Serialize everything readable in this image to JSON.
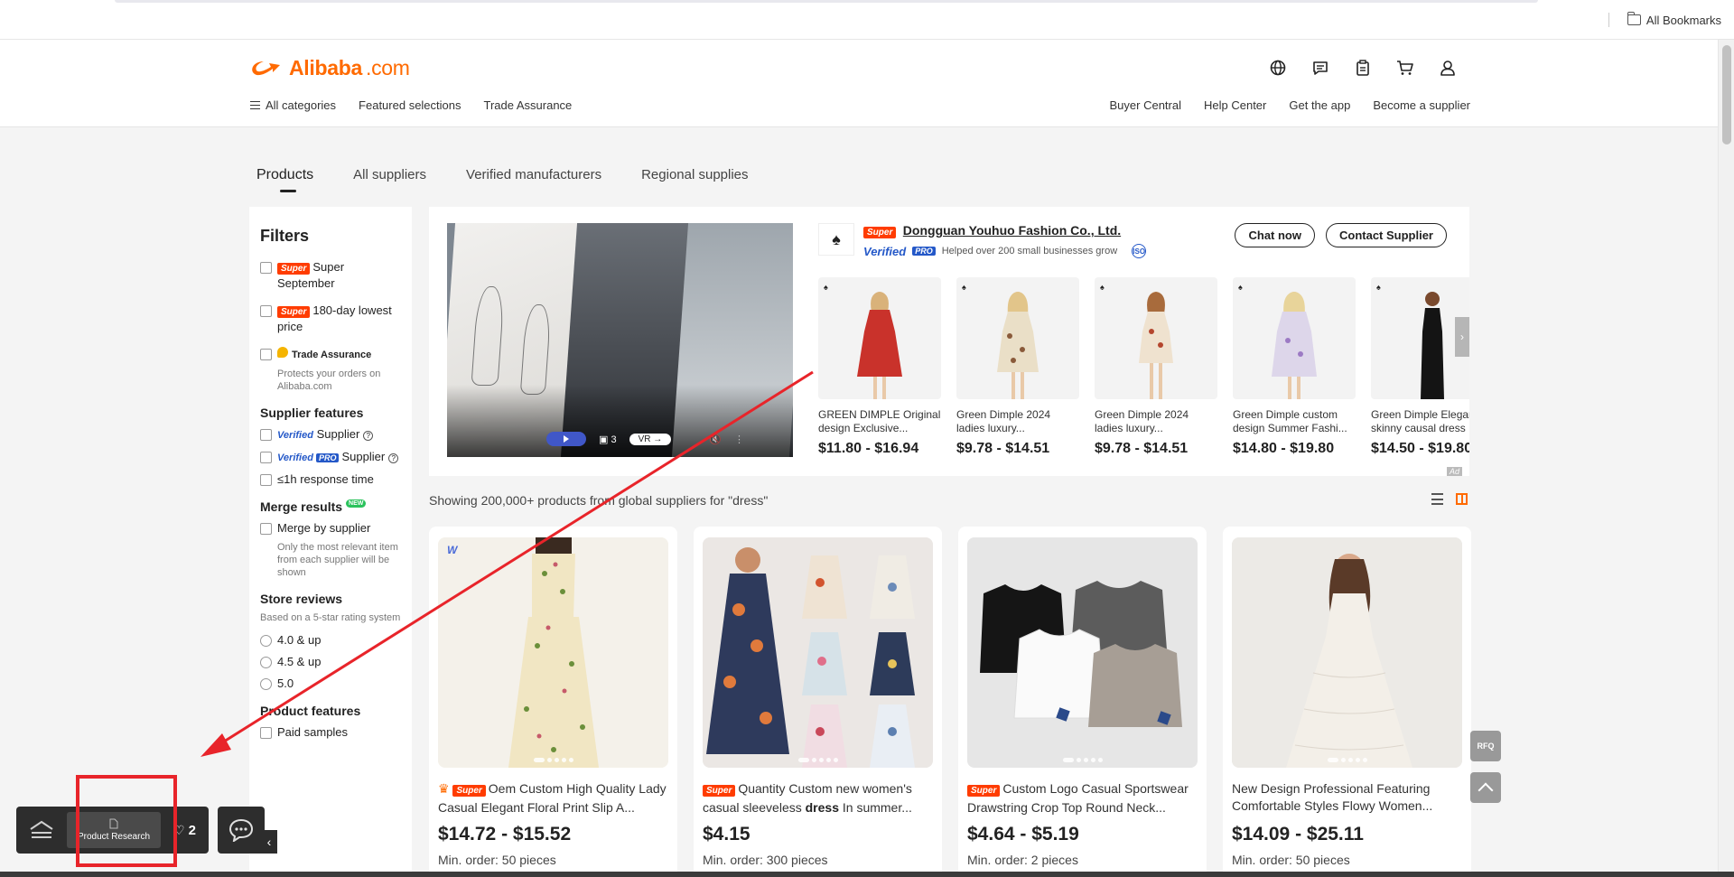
{
  "browser": {
    "bookmarks_label": "All Bookmarks"
  },
  "header": {
    "logo_text": "Alibaba",
    "logo_suffix": ".com",
    "icons": [
      "globe-icon",
      "message-icon",
      "orders-icon",
      "cart-icon",
      "user-icon"
    ],
    "nav_left": [
      "All categories",
      "Featured selections",
      "Trade Assurance"
    ],
    "nav_right": [
      "Buyer Central",
      "Help Center",
      "Get the app",
      "Become a supplier"
    ]
  },
  "tabs": [
    "Products",
    "All suppliers",
    "Verified manufacturers",
    "Regional supplies"
  ],
  "filters": {
    "title": "Filters",
    "super_tag": "Super",
    "super_september": "Super September",
    "lowest_price": "180-day lowest price",
    "trade_assurance": "Trade Assurance",
    "trade_assurance_note": "Protects your orders on Alibaba.com",
    "supplier_features_title": "Supplier features",
    "verified_word": "Verified",
    "pro_word": "PRO",
    "supplier_word": "Supplier",
    "response_time": "≤1h response time",
    "merge_title": "Merge results",
    "new_badge": "NEW",
    "merge_by_supplier": "Merge by supplier",
    "merge_note": "Only the most relevant item from each supplier will be shown",
    "reviews_title": "Store reviews",
    "reviews_note": "Based on a 5-star rating system",
    "rating_options": [
      "4.0 & up",
      "4.5 & up",
      "5.0"
    ],
    "product_features_title": "Product features",
    "paid_samples": "Paid samples"
  },
  "ad": {
    "supplier_name": "Dongguan Youhuo Fashion Co., Ltd.",
    "super_tag": "Super",
    "verified_word": "Verified",
    "pro_word": "PRO",
    "helped_text": "Helped over 200 small businesses grow",
    "iso_label": "ISO",
    "chat_now": "Chat now",
    "contact_supplier": "Contact Supplier",
    "image_count": "3",
    "vr_label": "VR",
    "ad_label": "Ad",
    "products": [
      {
        "title": "GREEN DIMPLE Original design Exclusive...",
        "price": "$11.80 - $16.94",
        "color": "#c9322b"
      },
      {
        "title": "Green Dimple 2024 ladies luxury...",
        "price": "$9.78 - $14.51",
        "color": "#e8dcc4"
      },
      {
        "title": "Green Dimple 2024 ladies luxury...",
        "price": "$9.78 - $14.51",
        "color": "#eadfce"
      },
      {
        "title": "Green Dimple custom design Summer Fashi...",
        "price": "$14.80 - $19.80",
        "color": "#d9d3e8"
      },
      {
        "title": "Green Dimple Elegant skinny causal dress",
        "price": "$14.50 - $19.80",
        "color": "#1a1a1a"
      }
    ]
  },
  "results": {
    "showing_text": "Showing 200,000+ products from global suppliers for \"dress\"",
    "products": [
      {
        "super": true,
        "title_pre": "Oem Custom High Quality Lady Casual Elegant Floral Print Slip A...",
        "title_bold": "",
        "title_post": "",
        "price": "$14.72 - $15.52",
        "min_order": "Min. order: 50 pieces",
        "bg": "#f5f0e4"
      },
      {
        "super": true,
        "title_pre": "Quantity Custom new women's casual sleeveless ",
        "title_bold": "dress",
        "title_post": " In summer...",
        "price": "$4.15",
        "min_order": "Min. order: 300 pieces",
        "bg": "#f2f2f2"
      },
      {
        "super": true,
        "title_pre": "Custom Logo Casual Sportswear Drawstring Crop Top Round Neck...",
        "title_bold": "",
        "title_post": "",
        "price": "$4.64 - $5.19",
        "min_order": "Min. order: 2 pieces",
        "bg": "#e9e9e9"
      },
      {
        "super": false,
        "title_pre": "New Design Professional Featuring Comfortable Styles Flowy Women...",
        "title_bold": "",
        "title_post": "",
        "price": "$14.09 - $25.11",
        "min_order": "Min. order: 50 pieces",
        "bg": "#ecebe8"
      }
    ]
  },
  "floating": {
    "rfq_label": "RFQ"
  },
  "extension": {
    "product_research": "Product Research",
    "favorites_count": "2"
  },
  "colors": {
    "brand": "#ff6a00",
    "super": "#ff3c00",
    "verified": "#2458c8",
    "annotation": "#e8242a"
  }
}
